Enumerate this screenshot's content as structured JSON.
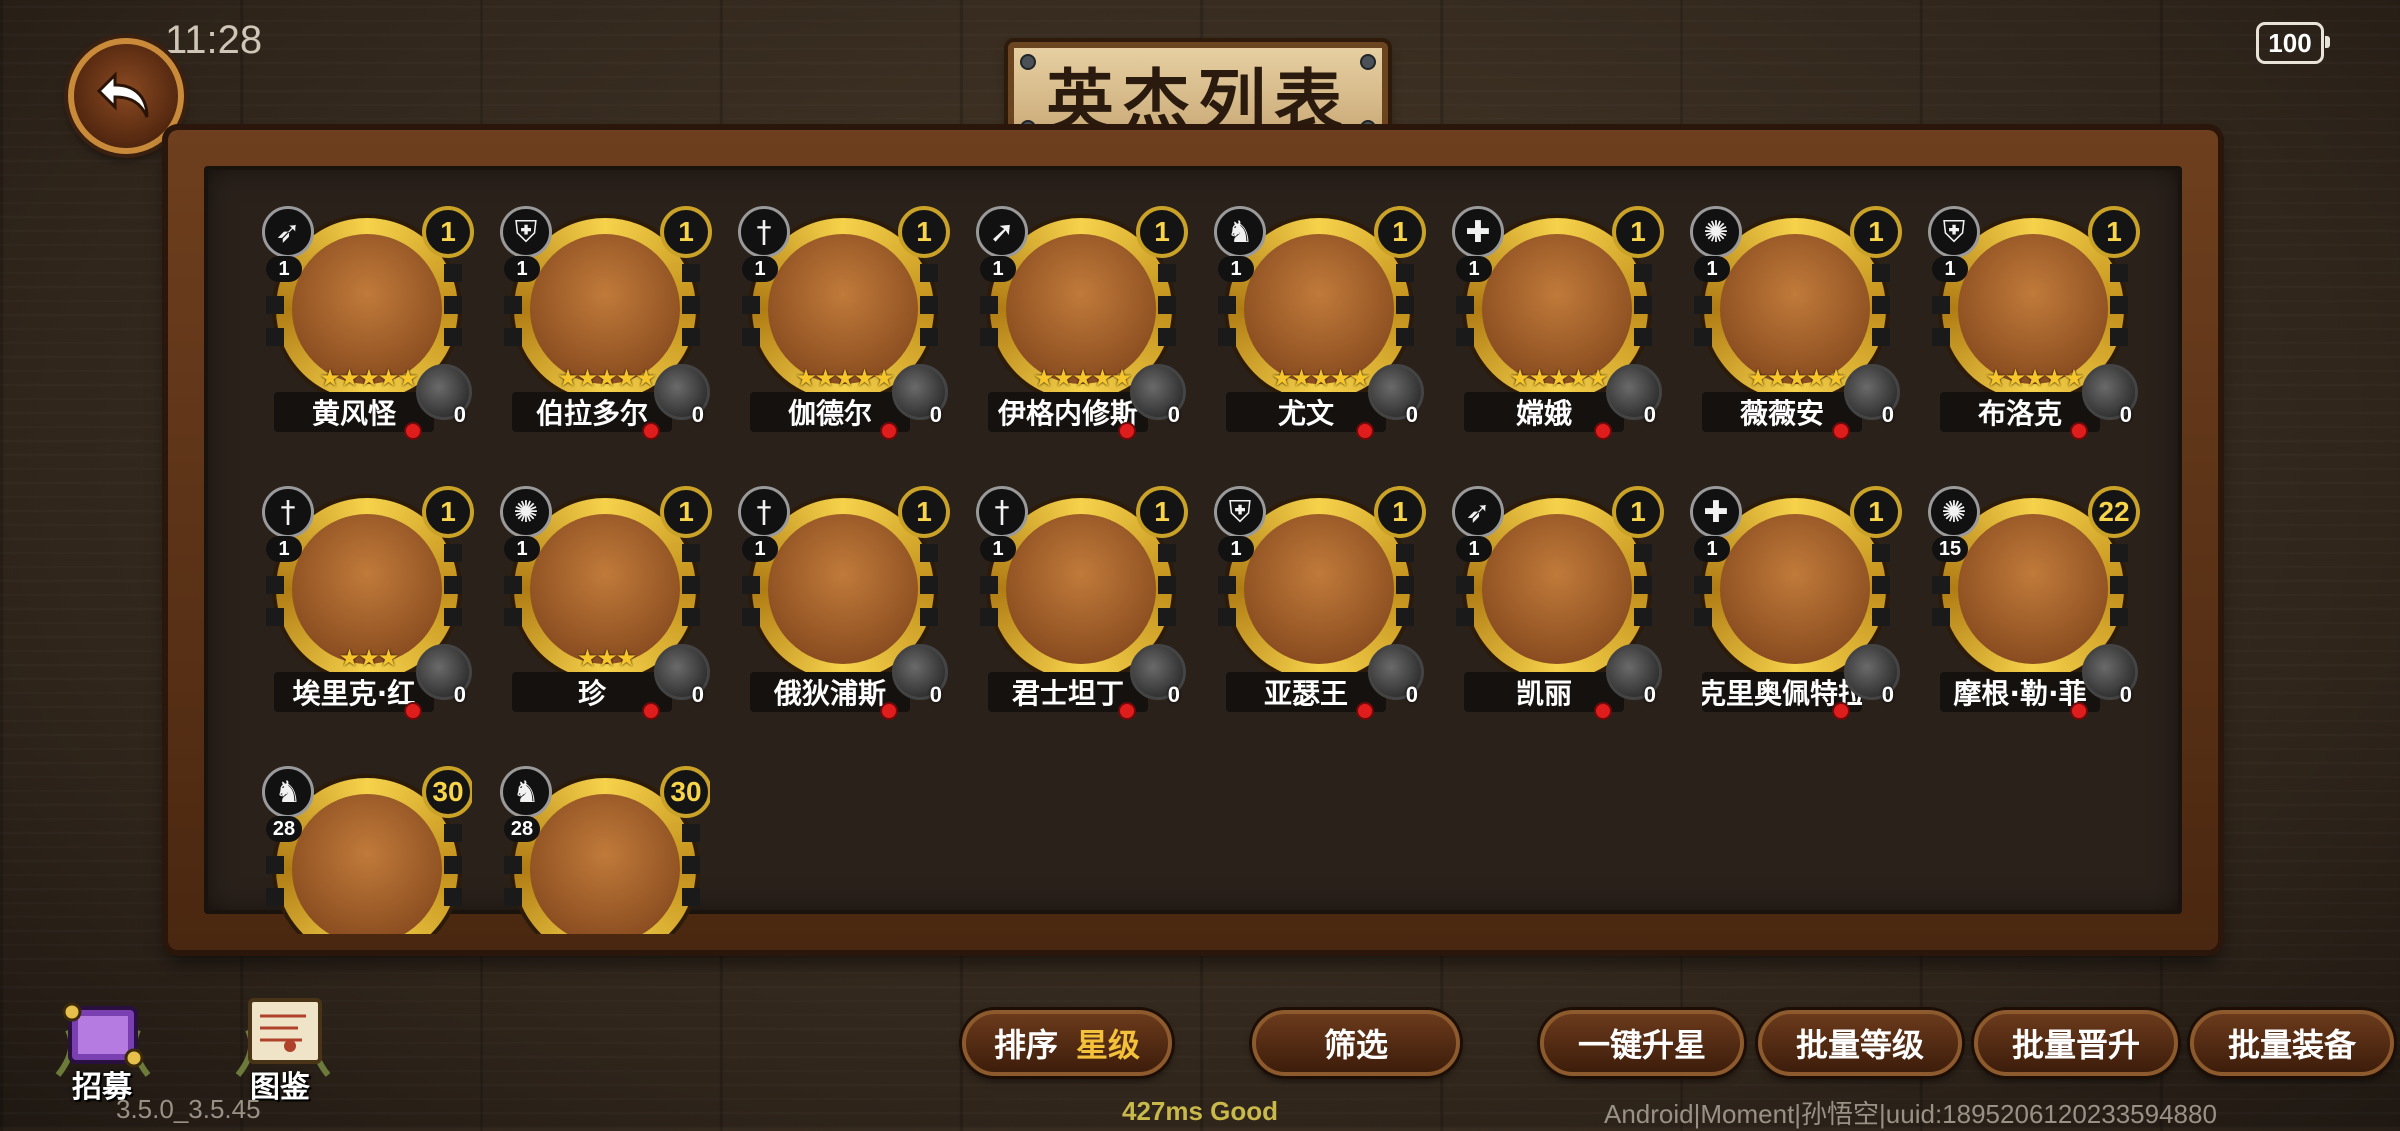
{
  "status": {
    "time": "11:28",
    "battery": "100"
  },
  "title": "英杰列表",
  "heroes": [
    {
      "name": "黄风怪",
      "grade": "1",
      "level": "1",
      "stars": 5,
      "class_icon": "bow-icon",
      "equip_count": "0"
    },
    {
      "name": "伯拉多尔",
      "grade": "1",
      "level": "1",
      "stars": 5,
      "class_icon": "shield-icon",
      "equip_count": "0"
    },
    {
      "name": "伽德尔",
      "grade": "1",
      "level": "1",
      "stars": 5,
      "class_icon": "sword-icon",
      "equip_count": "0"
    },
    {
      "name": "伊格内修斯",
      "grade": "1",
      "level": "1",
      "stars": 5,
      "class_icon": "spear-icon",
      "equip_count": "0"
    },
    {
      "name": "尤文",
      "grade": "1",
      "level": "1",
      "stars": 5,
      "class_icon": "horse-icon",
      "equip_count": "0"
    },
    {
      "name": "嫦娥",
      "grade": "1",
      "level": "1",
      "stars": 5,
      "class_icon": "cross-icon",
      "equip_count": "0"
    },
    {
      "name": "薇薇安",
      "grade": "1",
      "level": "1",
      "stars": 5,
      "class_icon": "flame-icon",
      "equip_count": "0"
    },
    {
      "name": "布洛克",
      "grade": "1",
      "level": "1",
      "stars": 5,
      "class_icon": "shield-icon",
      "equip_count": "0"
    },
    {
      "name": "埃里克·红",
      "grade": "1",
      "level": "1",
      "stars": 3,
      "class_icon": "sword-icon",
      "equip_count": "0"
    },
    {
      "name": "珍",
      "grade": "1",
      "level": "1",
      "stars": 3,
      "class_icon": "flame-icon",
      "equip_count": "0"
    },
    {
      "name": "俄狄浦斯",
      "grade": "1",
      "level": "1",
      "stars": 0,
      "class_icon": "sword-icon",
      "equip_count": "0"
    },
    {
      "name": "君士坦丁",
      "grade": "1",
      "level": "1",
      "stars": 0,
      "class_icon": "sword-icon",
      "equip_count": "0"
    },
    {
      "name": "亚瑟王",
      "grade": "1",
      "level": "1",
      "stars": 0,
      "class_icon": "shield-icon",
      "equip_count": "0"
    },
    {
      "name": "凯丽",
      "grade": "1",
      "level": "1",
      "stars": 0,
      "class_icon": "bow-icon",
      "equip_count": "0"
    },
    {
      "name": "克里奥佩特拉",
      "grade": "1",
      "level": "1",
      "stars": 0,
      "class_icon": "cross-icon",
      "equip_count": "0"
    },
    {
      "name": "摩根·勒·菲",
      "grade": "22",
      "level": "15",
      "stars": 0,
      "class_icon": "flame-icon",
      "equip_count": "0"
    },
    {
      "name": "",
      "grade": "30",
      "level": "28",
      "stars": 0,
      "class_icon": "horse-icon",
      "equip_count": ""
    },
    {
      "name": "",
      "grade": "30",
      "level": "28",
      "stars": 0,
      "class_icon": "horse-icon",
      "equip_count": ""
    }
  ],
  "buttons": {
    "sort_label": "排序",
    "sort_value": "星级",
    "filter": "筛选",
    "one_click_star": "一键升星",
    "batch_level": "批量等级",
    "batch_promote": "批量晋升",
    "batch_equip": "批量装备"
  },
  "menu": {
    "recruit": "招募",
    "codex": "图鉴"
  },
  "footer": {
    "version": "3.5.0_3.5.45",
    "ping": "427ms Good",
    "device": "Android|Moment|孙悟空|uuid:1895206120233594880"
  },
  "colors": {
    "gold": "#f6d24b",
    "ping_green": "#c9b94a",
    "accent": "#f4c13a"
  }
}
